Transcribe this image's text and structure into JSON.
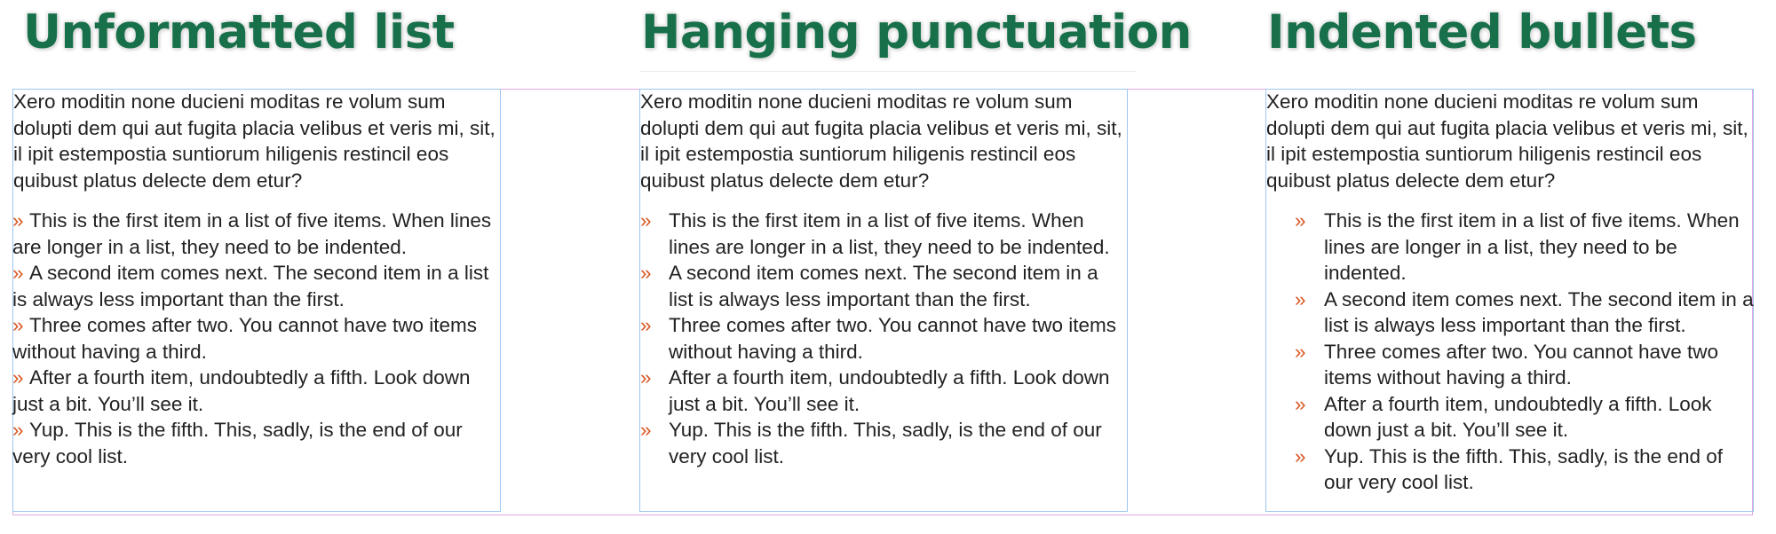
{
  "colors": {
    "heading": "#17704a",
    "bullet": "#d9541f",
    "text": "#222222",
    "frame": "#9cc6ee",
    "guide": "#e4a9e6"
  },
  "panels": [
    {
      "heading": "Unformatted list",
      "paragraph": "Xero moditin none ducieni moditas re volum sum dolupti dem qui aut fugita placia velibus et veris mi, sit, il ipit estempostia suntiorum hiligenis restincil eos quibust platus delecte dem etur?",
      "bullet": "»",
      "items": [
        "This is the first item in a list of five items. When lines are longer in a list, they need to be indented.",
        "A second item comes next. The second item in a list is always less important than the first.",
        "Three comes after two. You cannot have two items without having a third.",
        "After a fourth item, undoubtedly a fifth. Look down just a bit. You’ll see it.",
        "Yup. This is the fifth. This, sadly, is the end of our very cool list."
      ]
    },
    {
      "heading": "Hanging punctuation",
      "paragraph": "Xero moditin none ducieni moditas re volum sum dolupti dem qui aut fugita placia velibus et veris mi, sit, il ipit estempostia suntiorum hiligenis restincil eos quibust platus delecte dem etur?",
      "bullet": "»",
      "items": [
        "This is the first item in a list of five items. When lines are longer in a list, they need to be indented.",
        "A second item comes next. The second item in a list is always less important than the first.",
        "Three comes after two. You cannot have two items without having a third.",
        "After a fourth item, undoubtedly a fifth. Look down just a bit. You’ll see it.",
        "Yup. This is the fifth. This, sadly, is the end of our very cool list."
      ]
    },
    {
      "heading": "Indented bullets",
      "paragraph": "Xero moditin none ducieni moditas re volum sum dolupti dem qui aut fugita placia velibus et veris mi, sit, il ipit estempostia suntiorum hiligenis restincil eos quibust platus delecte dem etur?",
      "bullet": "»",
      "items": [
        "This is the first item in a list of five items. When lines are longer in a list, they need to be indented.",
        "A second item comes next. The second item in a list is always less important than the first.",
        "Three comes after two. You cannot have two items without having a third.",
        "After a fourth item, undoubtedly a fifth. Look down just a bit. You’ll see it.",
        "Yup. This is the fifth. This, sadly, is the end of our very cool list."
      ]
    }
  ]
}
